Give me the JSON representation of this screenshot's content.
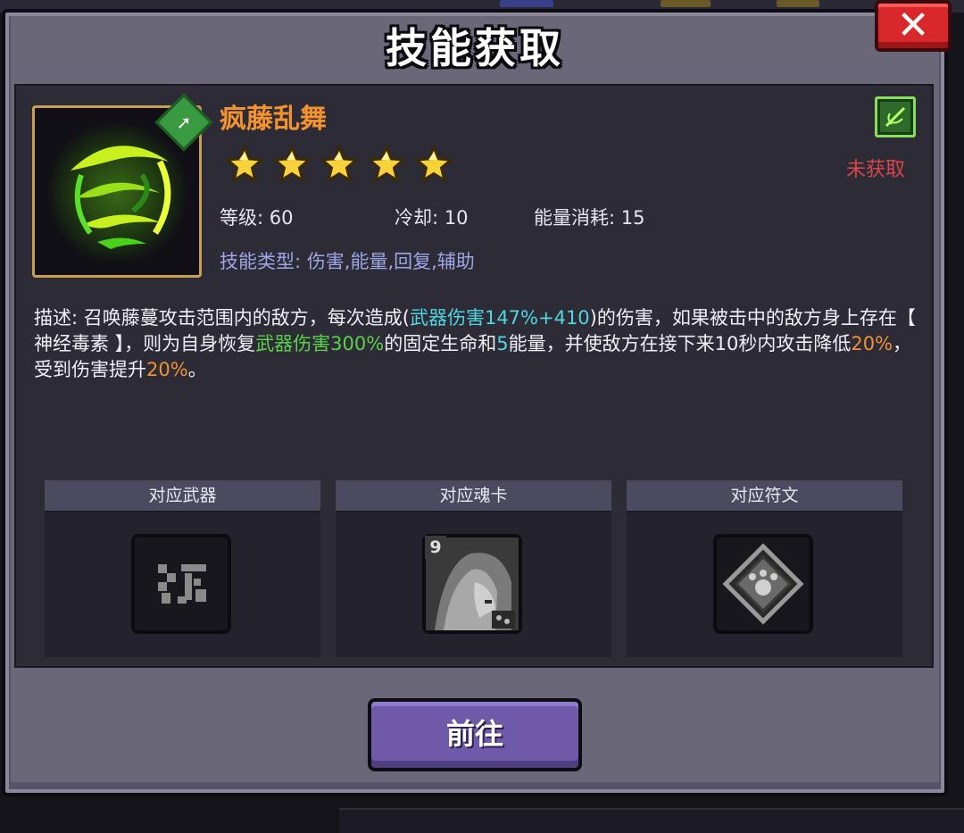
{
  "dialog": {
    "title": "技能获取",
    "close_label": "✕"
  },
  "skill": {
    "name": "疯藤乱舞",
    "stars": 5,
    "level_label": "等级: 60",
    "cooldown_label": "冷却: 10",
    "energy_label": "能量消耗: 15",
    "type_label": "技能类型:",
    "type_value": "伤害,能量,回复,辅助",
    "status": "未获取"
  },
  "description": {
    "p1": "描述: 召唤藤蔓攻击范围内的敌方，每次造成(",
    "h1": "武器伤害147%+410",
    "p2": ")的伤害，如果被击中的敌方身上存在【 神经毒素 】，则为自身恢复",
    "h2": "武器伤害300%",
    "p3": "的固定生命和",
    "h3": "5",
    "p4": "能量，并使敌方在接下来10秒内攻击降低",
    "h4": "20%",
    "p5": "，受到伤害提升",
    "h5": "20%",
    "p6": "。"
  },
  "slots": [
    {
      "header": "对应武器",
      "icon": "weapon-icon"
    },
    {
      "header": "对应魂卡",
      "icon": "soul-card-icon",
      "card_level": "9"
    },
    {
      "header": "对应符文",
      "icon": "rune-icon"
    }
  ],
  "actions": {
    "go_label": "前往"
  },
  "colors": {
    "skill_name": "#f4932e",
    "status": "#d8454a",
    "highlight_cyan": "#4fd6e0",
    "highlight_green": "#5ad24a",
    "highlight_orange": "#f19234",
    "button": "#6e5aa8"
  }
}
